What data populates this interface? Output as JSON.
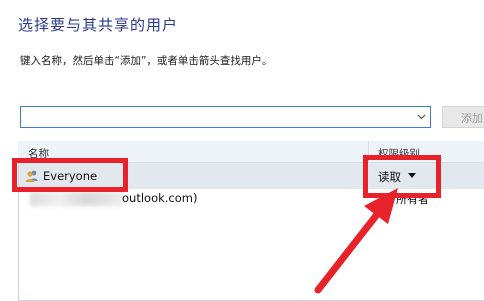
{
  "dialog": {
    "title": "选择要与其共享的用户",
    "instruction": "键入名称，然后单击“添加”，或者单击箭头查找用户。",
    "name_input": {
      "value": "",
      "placeholder": ""
    },
    "add_button_label": "添加"
  },
  "list": {
    "columns": {
      "name": "名称",
      "permission": "权限级别"
    },
    "rows": [
      {
        "name": "Everyone",
        "permission": "读取",
        "icon": "users-group-icon",
        "selected": true
      },
      {
        "name": "outlook.com)",
        "permission": "所有者",
        "icon": "blurred-user"
      }
    ]
  },
  "annotations": {
    "highlight_color": "#e8222b"
  }
}
